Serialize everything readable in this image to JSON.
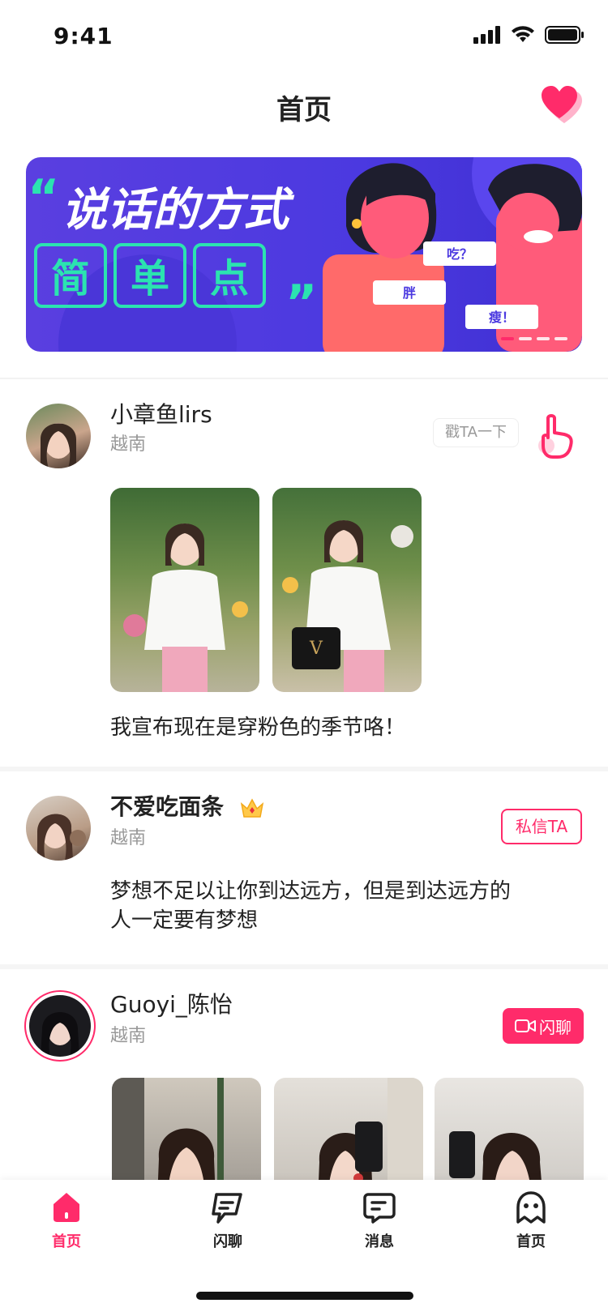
{
  "status": {
    "time": "9:41"
  },
  "header": {
    "title": "首页"
  },
  "banner": {
    "line1": "说话的方式",
    "line2": [
      "简",
      "单",
      "点"
    ],
    "bubbles": [
      "吃？",
      "胖",
      "瘦！"
    ]
  },
  "posts": [
    {
      "name": "小章鱼lirs",
      "location": "越南",
      "action_label": "戳TA一下",
      "content": "我宣布现在是穿粉色的季节咯！"
    },
    {
      "name": "不爱吃面条",
      "location": "越南",
      "action_label": "私信TA",
      "content_lines": [
        "梦想不足以让你到达远方，但是到达远方的",
        "人一定要有梦想"
      ]
    },
    {
      "name": "Guoyi_陈怡",
      "location": "越南",
      "action_label": "闪聊"
    }
  ],
  "tabbar": {
    "items": [
      {
        "label": "首页",
        "icon": "home-icon",
        "active": true
      },
      {
        "label": "闪聊",
        "icon": "flash-chat-icon"
      },
      {
        "label": "消息",
        "icon": "message-icon"
      },
      {
        "label": "首页",
        "icon": "ghost-icon"
      }
    ]
  },
  "colors": {
    "accent": "#ff2b6a",
    "banner_bg": "#4b39e0",
    "banner_text": "#ffffff",
    "banner_green": "#2be3b0"
  }
}
